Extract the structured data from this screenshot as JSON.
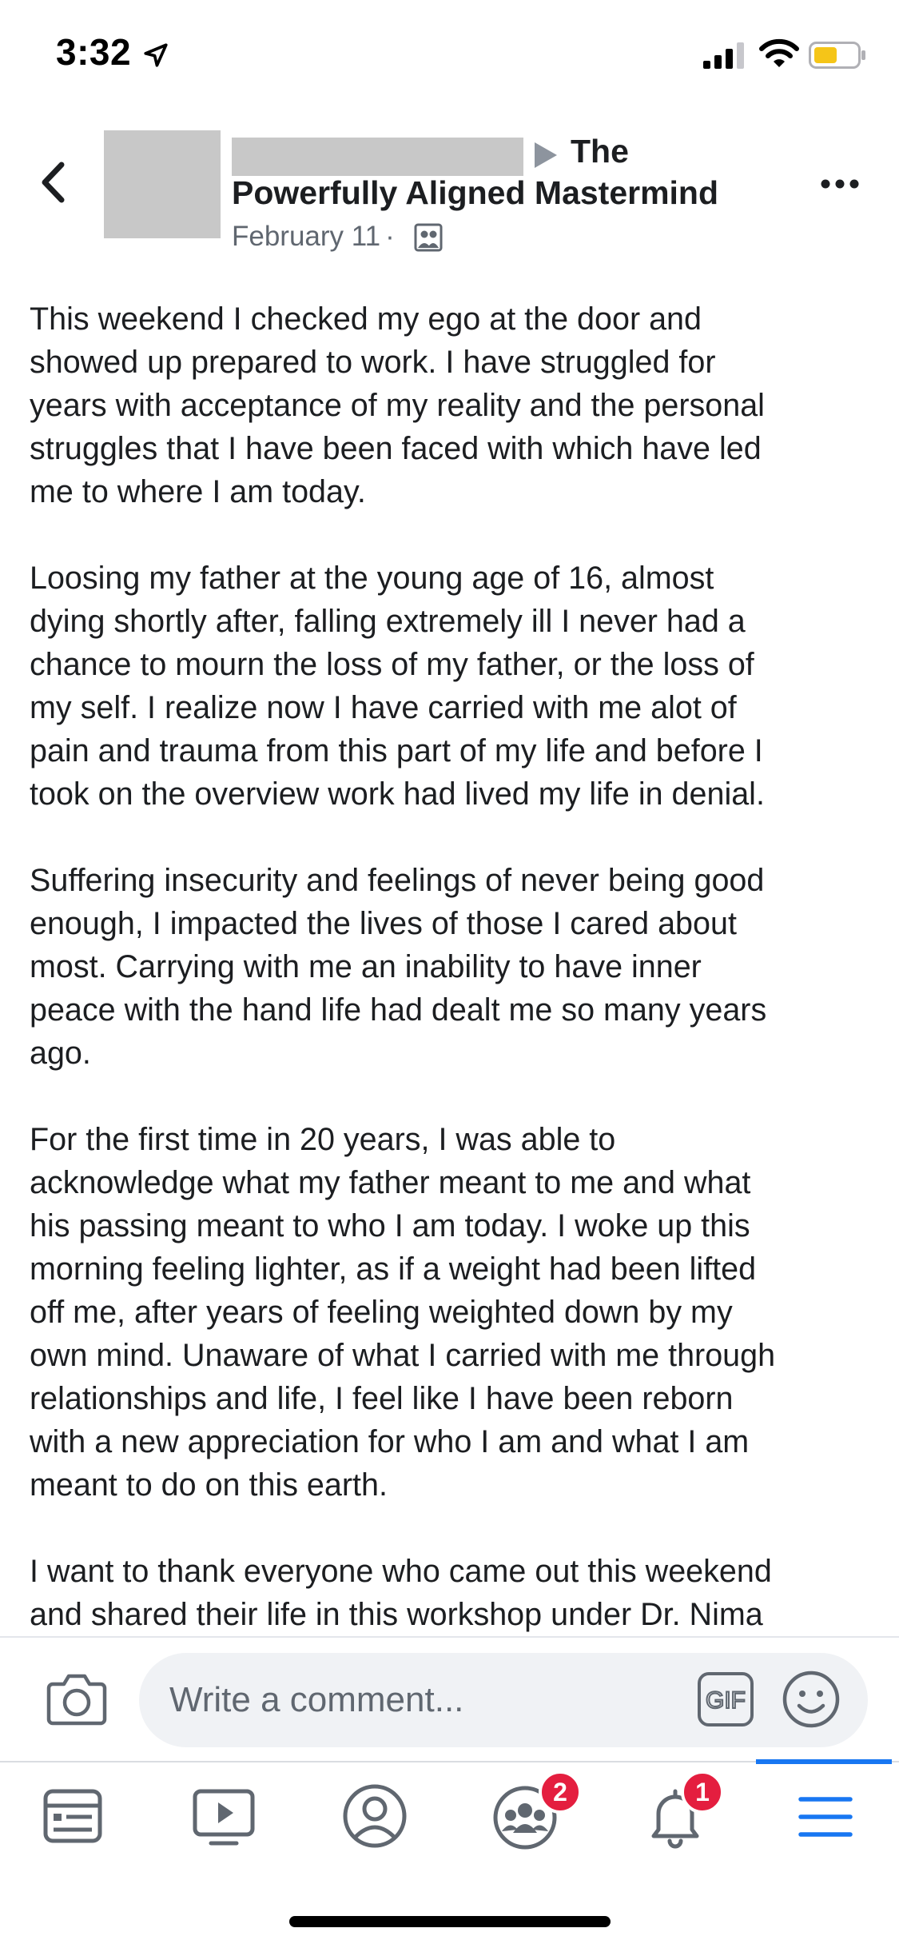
{
  "status_bar": {
    "time": "3:32"
  },
  "post": {
    "group_name_line1": "The",
    "group_name_line2": "Powerfully Aligned Mastermind",
    "date": "February 11",
    "separator": "·",
    "paragraphs": [
      "This weekend I checked my ego at the door and\nshowed up prepared to work. I have struggled for\nyears with acceptance of my reality and the personal\nstruggles that I have been faced with which have led\nme to where I am today.",
      "Loosing my father at the young age of 16, almost\ndying shortly after, falling extremely ill I never had a\nchance to mourn the loss of my father, or the loss of\nmy self. I realize now I have carried with me alot of\npain and trauma from this part of my life and before I\ntook on the overview work had lived my life in denial.",
      "Suffering insecurity and feelings of never being good\nenough, I impacted the lives of those I cared about\nmost. Carrying with me an inability to have inner\npeace with the hand life had dealt me so many years\nago.",
      "For the first time in 20 years, I was able to\nacknowledge what my father meant to me and what\nhis passing meant to who I am today. I woke up this\nmorning feeling lighter, as if a weight had been lifted\noff me, after years of feeling  weighted down by my\nown mind. Unaware of what I carried with me through\nrelationships and life, I feel like I have been reborn\nwith a new appreciation for who I am and what I am\nmeant to do on this earth.",
      "I want to thank everyone who came out this weekend\nand shared their life in this workshop under Dr. Nima"
    ]
  },
  "comment_bar": {
    "placeholder": "Write a comment...",
    "gif_label": "GIF"
  },
  "tab_bar": {
    "items": [
      {
        "name": "news-feed",
        "icon": "news-feed-icon"
      },
      {
        "name": "watch",
        "icon": "video-play-icon"
      },
      {
        "name": "profile",
        "icon": "profile-icon"
      },
      {
        "name": "groups",
        "icon": "groups-icon",
        "badge": "2"
      },
      {
        "name": "notifications",
        "icon": "bell-icon",
        "badge": "1"
      },
      {
        "name": "menu",
        "icon": "hamburger-menu-icon",
        "active": true
      }
    ]
  },
  "colors": {
    "accent": "#1877f2",
    "badge": "#e41e3f",
    "battery_fill": "#f5c518",
    "text_primary": "#1c1e21",
    "text_secondary": "#606770"
  }
}
